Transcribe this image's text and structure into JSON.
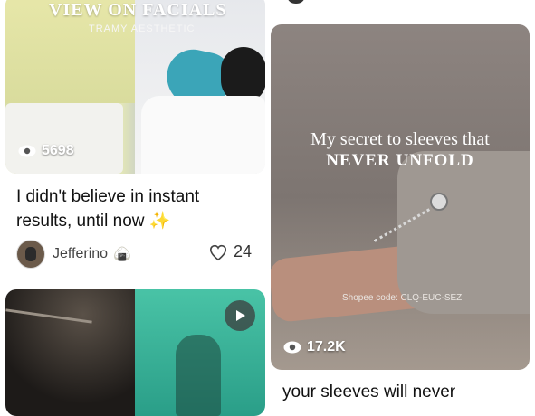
{
  "cards": [
    {
      "overlay_title": "VIEW ON FACIALS",
      "overlay_brand": "TRAMY AESTHETIC",
      "views": "5698",
      "title_line1": "I didn't believe in instant",
      "title_line2": "results, until now",
      "title_emoji": "✨",
      "author": "Jefferino",
      "author_emoji": "🍙",
      "likes": "24"
    },
    {
      "overlay_line1": "My secret to sleeves that",
      "overlay_line2": "NEVER UNFOLD",
      "shop_code": "Shopee code: CLQ-EUC-SEZ",
      "views": "17.2K",
      "title_line1": "your sleeves will never"
    },
    {
      "type": "video"
    }
  ],
  "icons": [
    "eye-icon",
    "heart-icon",
    "play-icon"
  ]
}
